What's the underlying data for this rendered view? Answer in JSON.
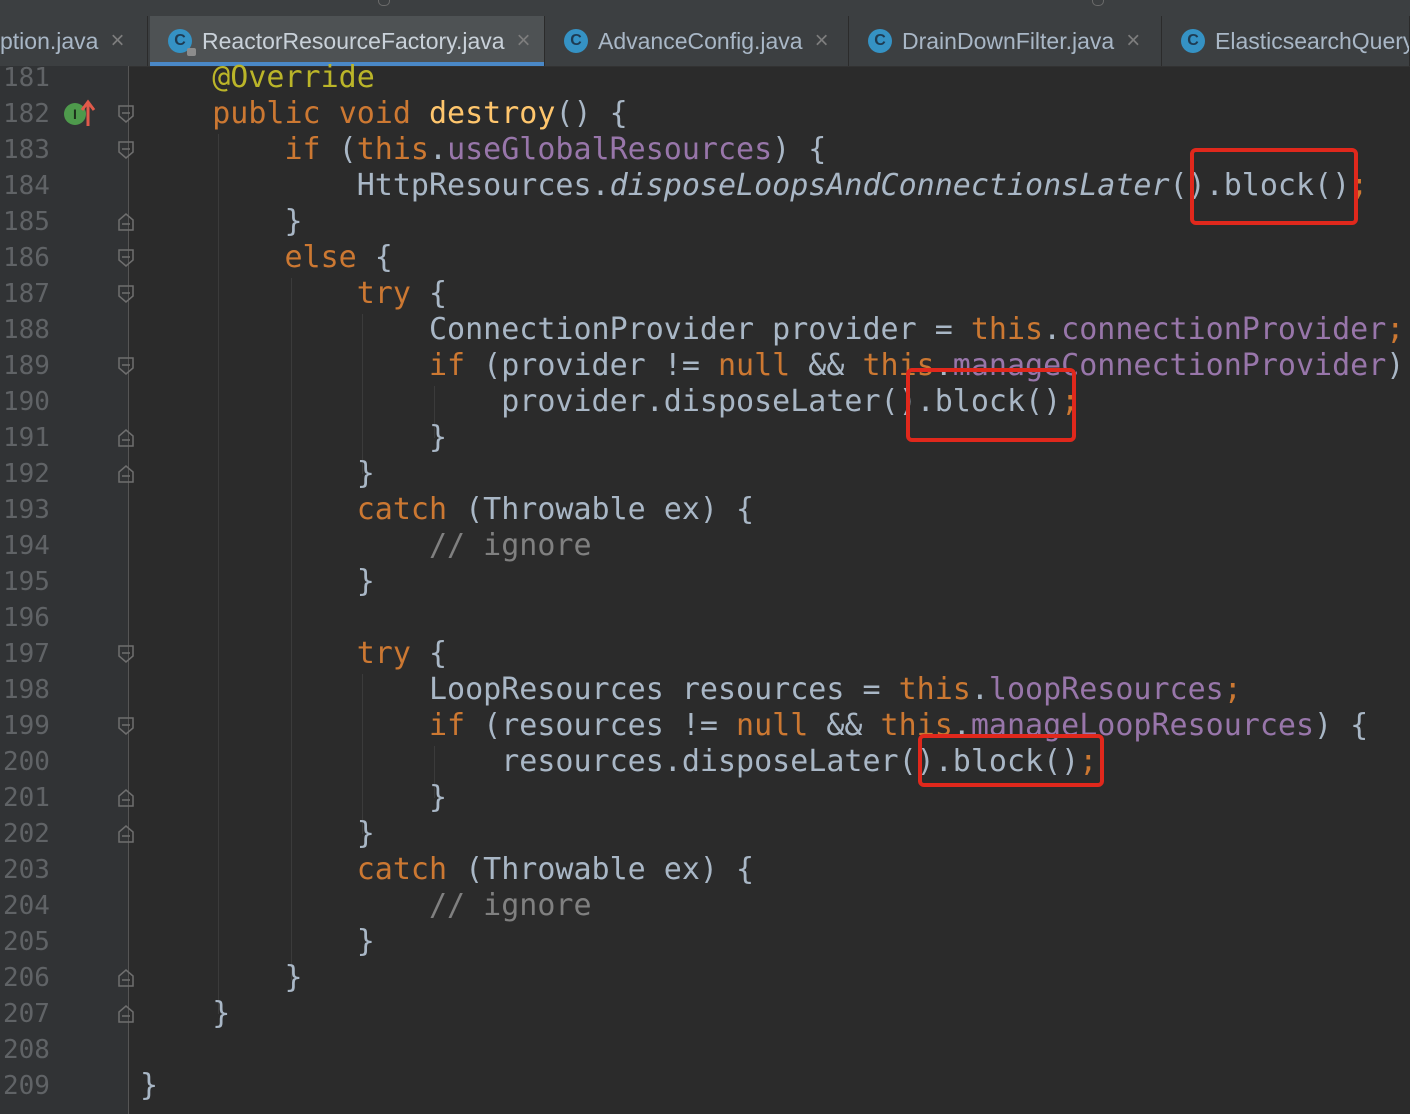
{
  "tabs": [
    {
      "name": "Option.java",
      "label": "ption.java",
      "active": false,
      "icon": "class-icon"
    },
    {
      "name": "ReactorResourceFactory.java",
      "label": "ReactorResourceFactory.java",
      "active": true,
      "icon": "class-icon"
    },
    {
      "name": "AdvanceConfig.java",
      "label": "AdvanceConfig.java",
      "active": false,
      "icon": "class-icon"
    },
    {
      "name": "DrainDownFilter.java",
      "label": "DrainDownFilter.java",
      "active": false,
      "icon": "class-icon"
    },
    {
      "name": "ElasticsearchQuery",
      "label": "ElasticsearchQuery",
      "active": false,
      "icon": "class-icon"
    }
  ],
  "editor": {
    "line_numbers": [
      "181",
      "182",
      "183",
      "184",
      "185",
      "186",
      "187",
      "188",
      "189",
      "190",
      "191",
      "192",
      "193",
      "194",
      "195",
      "196",
      "197",
      "198",
      "199",
      "200",
      "201",
      "202",
      "203",
      "204",
      "205",
      "206",
      "207",
      "208",
      "209"
    ],
    "tokens": {
      "override": "@Override",
      "public": "public",
      "void": "void",
      "destroy": "destroy",
      "destroy_tail": "() {",
      "if": "if",
      "open_paren": " (",
      "this": "this",
      "dot": ".",
      "useGlobalResources": "useGlobalResources",
      "close_brace_open": ") {",
      "http_resources": "HttpResources.",
      "dispose_loops": "disposeLoopsAndConnectionsLater",
      "paren_open": "(",
      "block_call": ").block()",
      "semicolon": ";",
      "close_brace": "}",
      "else": "else",
      "open_brace": " {",
      "try": "try",
      "conn_provider_decl": "ConnectionProvider provider = ",
      "connectionProvider": "connectionProvider",
      "provider_cond": " (provider != ",
      "null": "null",
      "and": " && ",
      "manageConnectionProvider": "manageConnectionProvider",
      "close_paren": ")",
      "provider_dispose": "provider.disposeLater().block()",
      "catch": "catch",
      "catch_args": " (Throwable ex) {",
      "comment_ignore": "// ignore",
      "loop_decl": "LoopResources resources = ",
      "loopResources": "loopResources",
      "resources_cond": " (resources != ",
      "manageLoopResources": "manageLoopResources",
      "resources_dispose": "resources.disposeLater().block()"
    }
  },
  "colors": {
    "background": "#2b2b2b",
    "gutter": "#313335",
    "keyword": "#cc7832",
    "annotation": "#bbb529",
    "method": "#ffc66d",
    "field": "#9876aa",
    "comment": "#808080",
    "text": "#a9b7c6",
    "highlight_box": "#e0281c",
    "tab_accent": "#4a88c7"
  },
  "gutter_icons": {
    "line_182": "implementing-method-icon"
  }
}
